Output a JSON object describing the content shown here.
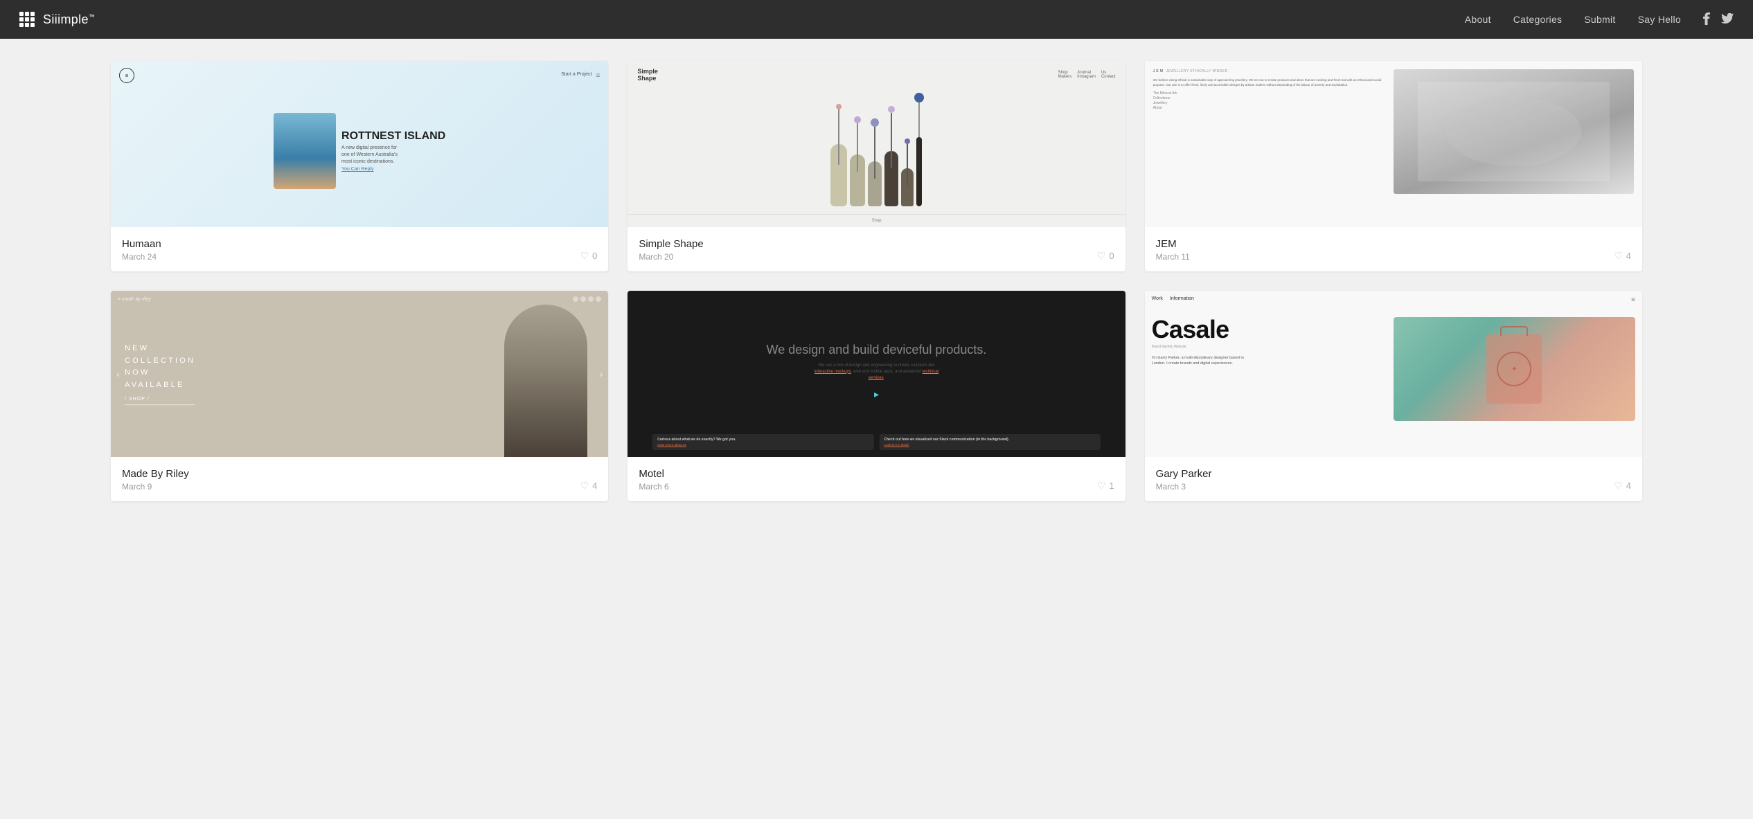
{
  "header": {
    "logo_title": "Siiimple",
    "logo_tm": "™",
    "nav": {
      "about": "About",
      "categories": "Categories",
      "submit": "Submit",
      "say_hello": "Say Hello"
    },
    "social": {
      "facebook": "f",
      "twitter": "🐦"
    }
  },
  "grid": {
    "cards": [
      {
        "id": "humaan",
        "title": "Humaan",
        "date": "March 24",
        "likes": 0,
        "thumbnail_alt": "Humaan website screenshot"
      },
      {
        "id": "simple-shape",
        "title": "Simple Shape",
        "date": "March 20",
        "likes": 0,
        "thumbnail_alt": "Simple Shape website screenshot"
      },
      {
        "id": "jem",
        "title": "JEM",
        "date": "March 11",
        "likes": 4,
        "thumbnail_alt": "JEM website screenshot"
      },
      {
        "id": "made-by-riley",
        "title": "Made By Riley",
        "date": "March 9",
        "likes": 4,
        "thumbnail_alt": "Made By Riley website screenshot"
      },
      {
        "id": "motel",
        "title": "Motel",
        "date": "March 6",
        "likes": 1,
        "thumbnail_alt": "Motel website screenshot"
      },
      {
        "id": "gary-parker",
        "title": "Gary Parker",
        "date": "March 3",
        "likes": 4,
        "thumbnail_alt": "Gary Parker website screenshot"
      }
    ],
    "humaan_content": {
      "island_title": "ROTTNEST ISLAND",
      "subtitle": "A new digital presence for one of Western Australia's most iconic destinations.",
      "link": "You Can Reply"
    },
    "simpleshape_content": {
      "logo": "Simple Shape",
      "nav_items": [
        "Shop Makers",
        "Journal Instagram",
        "Us Contact"
      ]
    },
    "jem_content": {
      "tagline": "JEWELLERY ETHICALLY MINDED",
      "body": "We believe doing ethical is sustainable way of approaching jewellery"
    },
    "madebyriley_content": {
      "headline_line1": "NEW",
      "headline_line2": "COLLECTION",
      "headline_line3": "NOW",
      "headline_line4": "AVAILABLE",
      "shop_label": "/ SHOP /"
    },
    "motel_content": {
      "headline": "We design and build deviceful products.",
      "subtext": "We use a mix of design and engineering to create solutions like interactive mockups, web and mobile apps, and advanced technical services.",
      "popup1_title": "Curious about what we do exactly? We got you.",
      "popup1_link": "Learn more about us",
      "popup2_title": "Check out how we visualized our Slack communication (in the background).",
      "popup2_link": "Look at it in detail:"
    },
    "garyparker_content": {
      "brand_name": "Casale",
      "description": "I'm Garry Parker, a multi-disciplinary designer based in London. I create brands and digital experiences.",
      "sub": "Brand Identity Website"
    }
  }
}
